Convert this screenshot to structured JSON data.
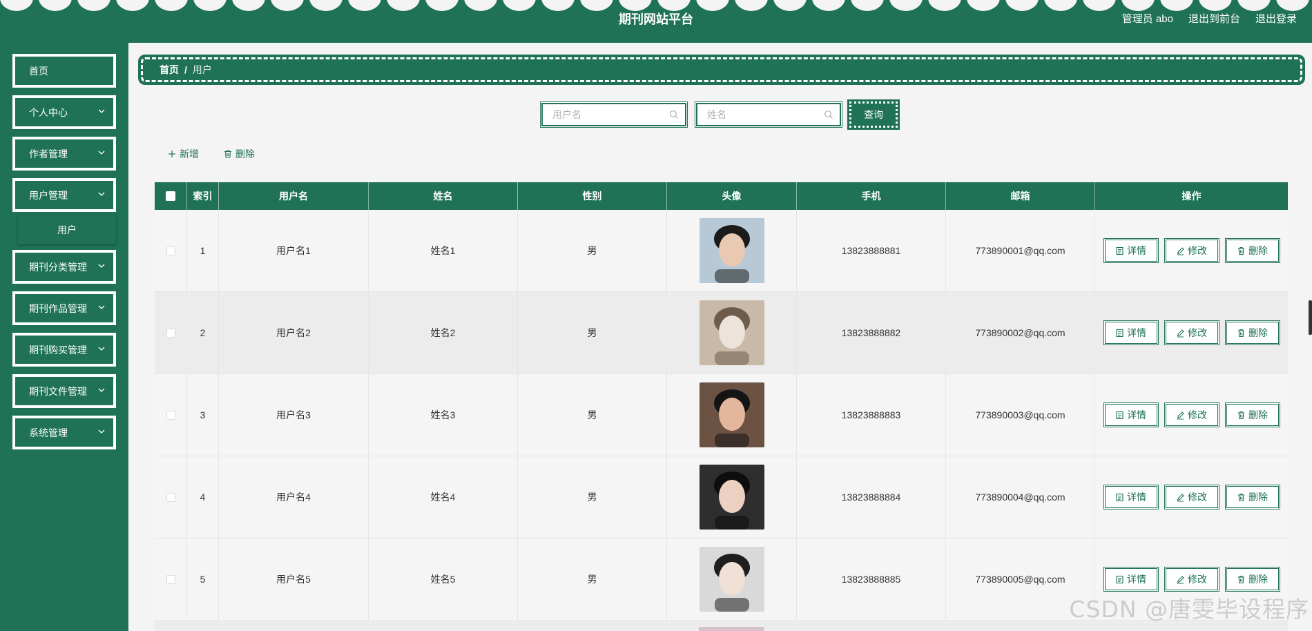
{
  "header": {
    "title": "期刊网站平台",
    "admin_label": "管理员 abo",
    "to_front_label": "退出到前台",
    "logout_label": "退出登录"
  },
  "sidebar": {
    "items": [
      {
        "label": "首页",
        "has_children": false
      },
      {
        "label": "个人中心",
        "has_children": true
      },
      {
        "label": "作者管理",
        "has_children": true
      },
      {
        "label": "用户管理",
        "has_children": true,
        "expanded": true
      },
      {
        "label": "期刊分类管理",
        "has_children": true
      },
      {
        "label": "期刊作品管理",
        "has_children": true
      },
      {
        "label": "期刊购买管理",
        "has_children": true
      },
      {
        "label": "期刊文件管理",
        "has_children": true
      },
      {
        "label": "系统管理",
        "has_children": true
      }
    ],
    "submenu": {
      "label": "用户"
    }
  },
  "breadcrumb": {
    "home": "首页",
    "separator": "/",
    "current": "用户"
  },
  "search": {
    "username_placeholder": "用户名",
    "name_placeholder": "姓名",
    "button_label": "查询"
  },
  "toolbar": {
    "add_label": "新增",
    "delete_label": "删除"
  },
  "table": {
    "headers": {
      "index": "索引",
      "username": "用户名",
      "name": "姓名",
      "gender": "性别",
      "avatar": "头像",
      "phone": "手机",
      "email": "邮箱",
      "ops": "操作"
    },
    "rows": [
      {
        "index": "1",
        "username": "用户名1",
        "name": "姓名1",
        "gender": "男",
        "phone": "13823888881",
        "email": "773890001@qq.com"
      },
      {
        "index": "2",
        "username": "用户名2",
        "name": "姓名2",
        "gender": "男",
        "phone": "13823888882",
        "email": "773890002@qq.com"
      },
      {
        "index": "3",
        "username": "用户名3",
        "name": "姓名3",
        "gender": "男",
        "phone": "13823888883",
        "email": "773890003@qq.com"
      },
      {
        "index": "4",
        "username": "用户名4",
        "name": "姓名4",
        "gender": "男",
        "phone": "13823888884",
        "email": "773890004@qq.com"
      },
      {
        "index": "5",
        "username": "用户名5",
        "name": "姓名5",
        "gender": "男",
        "phone": "13823888885",
        "email": "773890005@qq.com"
      }
    ],
    "op_labels": {
      "detail": "详情",
      "edit": "修改",
      "delete": "删除"
    }
  },
  "watermark": "CSDN @唐雯毕设程序",
  "colors": {
    "primary": "#1f7256",
    "background": "#f4f4f4",
    "row_alt": "#ececec"
  }
}
